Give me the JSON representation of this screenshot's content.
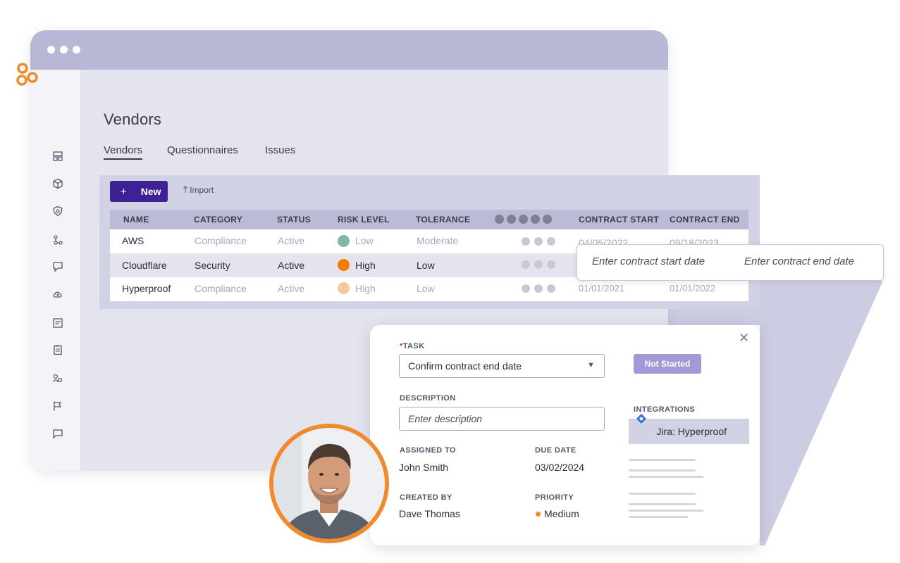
{
  "sidebar": {
    "icons": [
      "logo-icon",
      "dashboard-icon",
      "cube-icon",
      "shield-icon",
      "workflow-icon",
      "comment-icon",
      "cloud-icon",
      "report-icon",
      "clipboard-icon",
      "people-icon",
      "flag-icon",
      "chat-icon"
    ]
  },
  "page": {
    "title": "Vendors",
    "tabs": [
      "Vendors",
      "Questionnaires",
      "Issues"
    ]
  },
  "toolbar": {
    "new_label": "New",
    "new_plus": "+",
    "import_label": "Import"
  },
  "table": {
    "headers": [
      "NAME",
      "CATEGORY",
      "STATUS",
      "RISK LEVEL",
      "TOLERANCE",
      "CONTRACT START",
      "CONTRACT END"
    ],
    "rows": [
      {
        "name": "AWS",
        "category": "Compliance",
        "status": "Active",
        "risk": "Low",
        "tolerance": "Moderate",
        "start": "04/05/2022",
        "end": "09/18/2023",
        "risk_color": "#7fb8a4"
      },
      {
        "name": "Cloudflare",
        "category": "Security",
        "status": "Active",
        "risk": "High",
        "tolerance": "Low",
        "start": "",
        "end": "",
        "risk_color": "#f57c00"
      },
      {
        "name": "Hyperproof",
        "category": "Compliance",
        "status": "Active",
        "risk": "High",
        "tolerance": "Low",
        "start": "01/01/2021",
        "end": "01/01/2022",
        "risk_color": "#f8c79c"
      }
    ]
  },
  "tooltip": {
    "start_placeholder": "Enter contract start date",
    "end_placeholder": "Enter contract end date"
  },
  "task": {
    "task_label": "TASK",
    "required_mark": "*",
    "task_value": "Confirm contract end date",
    "status": "Not Started",
    "description_label": "DESCRIPTION",
    "description_placeholder": "Enter description",
    "integrations_label": "INTEGRATIONS",
    "integration_value": "Jira: Hyperproof",
    "assigned_label": "ASSIGNED TO",
    "assigned_value": "John Smith",
    "due_label": "DUE DATE",
    "due_value": "03/02/2024",
    "created_label": "CREATED BY",
    "created_value": "Dave Thomas",
    "priority_label": "PRIORITY",
    "priority_value": "Medium",
    "close_glyph": "✕"
  },
  "colors": {
    "accent": "#3f2196",
    "orange": "#f08a2c",
    "status_badge": "#a498d6"
  }
}
